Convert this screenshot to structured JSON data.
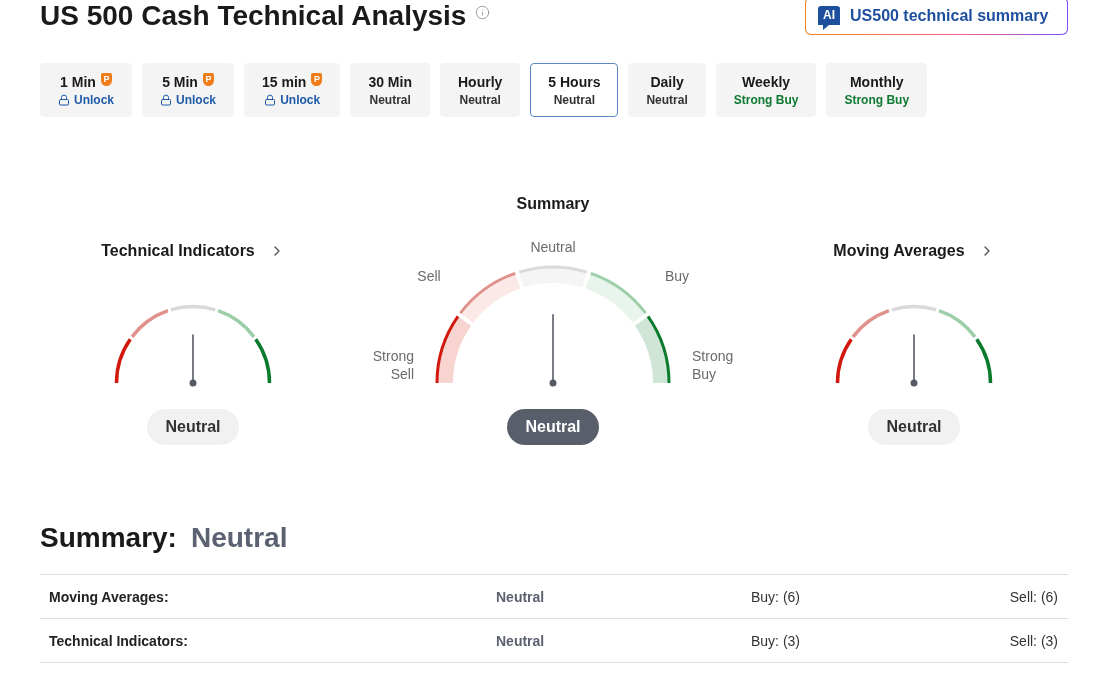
{
  "page": {
    "title": "US 500 Cash Technical Analysis"
  },
  "ai_button": {
    "icon_text": "AI",
    "label": "US500 technical summary"
  },
  "timeframes": [
    {
      "label": "1 Min",
      "badge": "P",
      "status": "Unlock",
      "locked": true,
      "selected": false,
      "color": "#1e5aa8"
    },
    {
      "label": "5 Min",
      "badge": "P",
      "status": "Unlock",
      "locked": true,
      "selected": false,
      "color": "#1e5aa8"
    },
    {
      "label": "15 min",
      "badge": "P",
      "status": "Unlock",
      "locked": true,
      "selected": false,
      "color": "#1e5aa8"
    },
    {
      "label": "30 Min",
      "status": "Neutral",
      "locked": false,
      "selected": false,
      "color": "#333333"
    },
    {
      "label": "Hourly",
      "status": "Neutral",
      "locked": false,
      "selected": false,
      "color": "#333333"
    },
    {
      "label": "5 Hours",
      "status": "Neutral",
      "locked": false,
      "selected": true,
      "color": "#333333"
    },
    {
      "label": "Daily",
      "status": "Neutral",
      "locked": false,
      "selected": false,
      "color": "#333333"
    },
    {
      "label": "Weekly",
      "status": "Strong Buy",
      "locked": false,
      "selected": false,
      "color": "#0e7a31"
    },
    {
      "label": "Monthly",
      "status": "Strong Buy",
      "locked": false,
      "selected": false,
      "color": "#0e7a31"
    }
  ],
  "gauges": [
    {
      "kind": "compact",
      "title": "Technical Indicators",
      "level": 0.5,
      "reading": "Neutral"
    },
    {
      "kind": "main",
      "title": "Summary",
      "scale": [
        "Strong Sell",
        "Sell",
        "Neutral",
        "Buy",
        "Strong Buy"
      ],
      "level": 0.5,
      "reading": "Neutral"
    },
    {
      "kind": "compact",
      "title": "Moving Averages",
      "level": 0.5,
      "reading": "Neutral"
    }
  ],
  "summary": {
    "label": "Summary:",
    "value": "Neutral"
  },
  "summary_table": [
    {
      "name": "Moving Averages:",
      "signal": "Neutral",
      "buy": "Buy: (6)",
      "sell": "Sell: (6)"
    },
    {
      "name": "Technical Indicators:",
      "signal": "Neutral",
      "buy": "Buy: (3)",
      "sell": "Sell: (3)"
    }
  ]
}
